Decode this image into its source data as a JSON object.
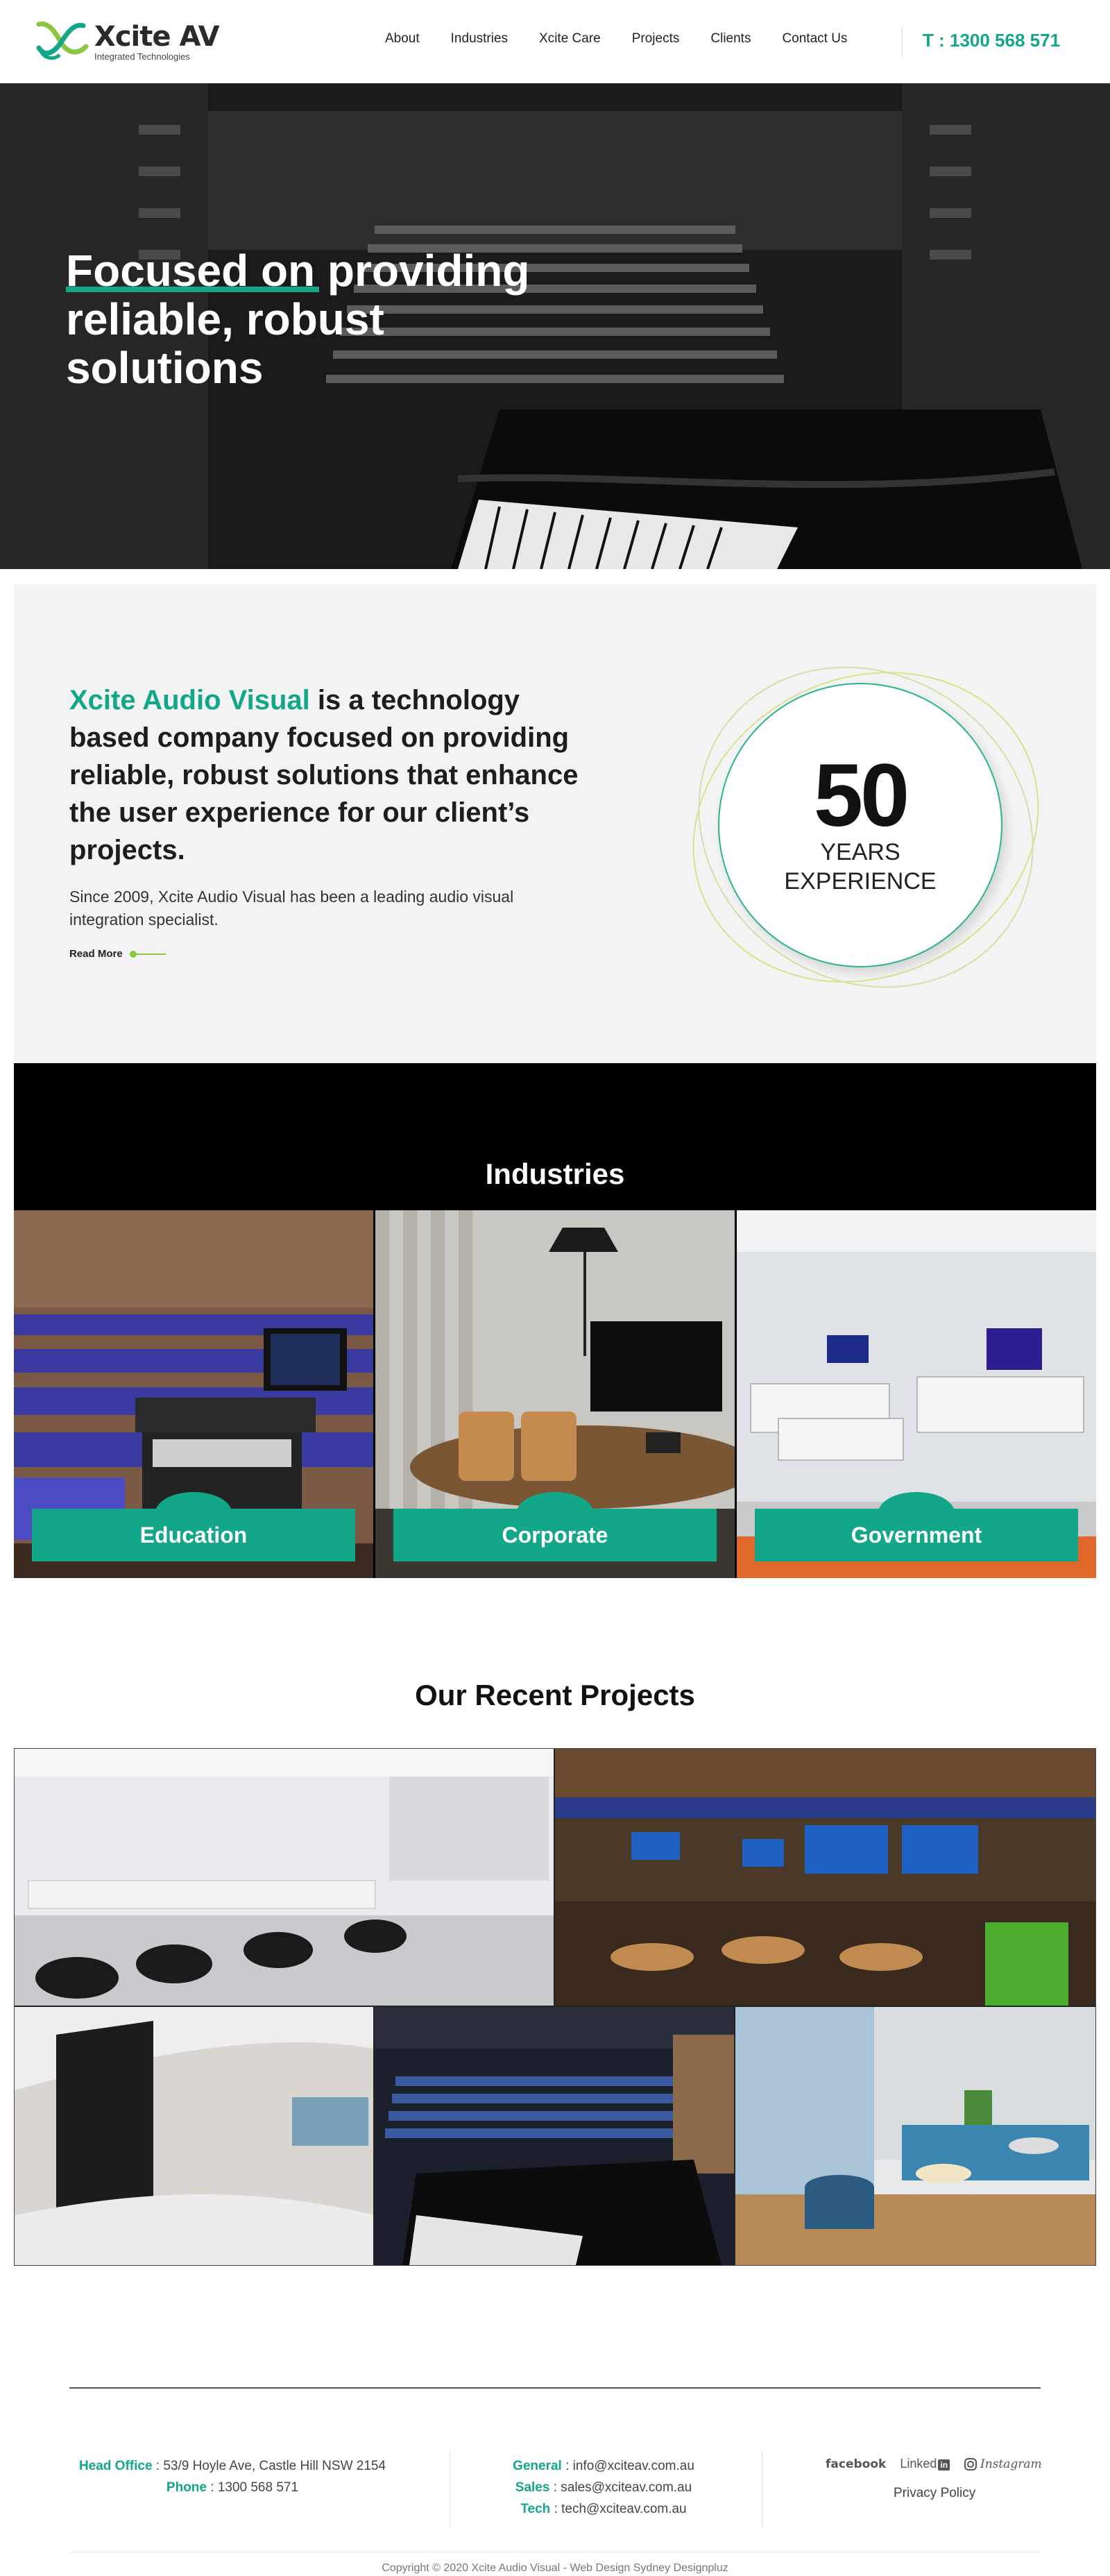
{
  "header": {
    "logo_name": "Xcite AV",
    "logo_tagline": "Integrated Technologies",
    "nav": [
      "About",
      "Industries",
      "Xcite Care",
      "Projects",
      "Clients",
      "Contact Us"
    ],
    "phone": "T : 1300 568 571"
  },
  "hero": {
    "title": "Focused on providing reliable, robust solutions"
  },
  "about": {
    "brand": "Xcite Audio Visual",
    "heading_rest": " is a technology based company focused on providing reliable, robust solutions that enhance the user experience for our client’s projects.",
    "sub": "Since 2009, Xcite Audio Visual has been a leading audio visual integration specialist.",
    "read_more": "Read More",
    "experience_number": "50",
    "experience_label_1": "YEARS",
    "experience_label_2": "EXPERIENCE"
  },
  "industries": {
    "title": "Industries",
    "items": [
      "Education",
      "Corporate",
      "Government"
    ]
  },
  "projects": {
    "title": "Our Recent Projects"
  },
  "footer": {
    "head_office_label": "Head Office",
    "head_office": " : 53/9 Hoyle Ave, Castle Hill NSW 2154",
    "phone_label": "Phone",
    "phone": " : 1300 568 571",
    "general_label": "General",
    "general": " : info@xciteav.com.au",
    "sales_label": "Sales",
    "sales": " : sales@xciteav.com.au",
    "tech_label": "Tech",
    "tech": " : tech@xciteav.com.au",
    "facebook": "facebook",
    "linkedin": "Linked",
    "linkedin_badge": "in",
    "instagram": "Instagram",
    "privacy": "Privacy Policy",
    "copyright": "Copyright ©  2020 Xcite Audio Visual - Web Design Sydney Designpluz"
  },
  "colors": {
    "accent": "#12a788",
    "lime": "#8cc63f"
  }
}
